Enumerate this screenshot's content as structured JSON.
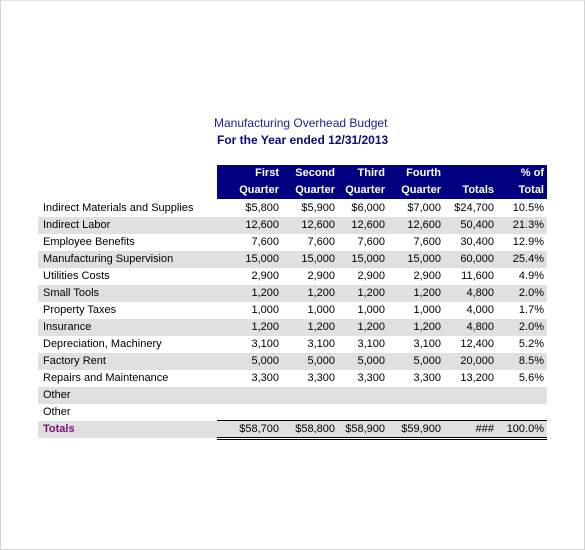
{
  "document": {
    "title": "Manufacturing Overhead Budget",
    "subtitle": "For the Year ended 12/31/2013"
  },
  "colors": {
    "header_bg": "#000080",
    "header_text": "#ffffff",
    "row_shade": "#e0e0e0",
    "title_text": "#1f1f8f",
    "totals_label": "#7f0f80"
  },
  "table": {
    "headers": [
      {
        "line1": "First",
        "line2": "Quarter"
      },
      {
        "line1": "Second",
        "line2": "Quarter"
      },
      {
        "line1": "Third",
        "line2": "Quarter"
      },
      {
        "line1": "Fourth",
        "line2": "Quarter"
      },
      {
        "line1": "",
        "line2": "Totals"
      },
      {
        "line1": "% of",
        "line2": "Total"
      }
    ],
    "rows": [
      {
        "label": "Indirect Materials and Supplies",
        "values": [
          "$5,800",
          "$5,900",
          "$6,000",
          "$7,000",
          "$24,700",
          "10.5%"
        ]
      },
      {
        "label": "Indirect Labor",
        "values": [
          "12,600",
          "12,600",
          "12,600",
          "12,600",
          "50,400",
          "21.3%"
        ]
      },
      {
        "label": "Employee Benefits",
        "values": [
          "7,600",
          "7,600",
          "7,600",
          "7,600",
          "30,400",
          "12.9%"
        ]
      },
      {
        "label": "Manufacturing Supervision",
        "values": [
          "15,000",
          "15,000",
          "15,000",
          "15,000",
          "60,000",
          "25.4%"
        ]
      },
      {
        "label": "Utilities Costs",
        "values": [
          "2,900",
          "2,900",
          "2,900",
          "2,900",
          "11,600",
          "4.9%"
        ]
      },
      {
        "label": "Small Tools",
        "values": [
          "1,200",
          "1,200",
          "1,200",
          "1,200",
          "4,800",
          "2.0%"
        ]
      },
      {
        "label": "Property Taxes",
        "values": [
          "1,000",
          "1,000",
          "1,000",
          "1,000",
          "4,000",
          "1.7%"
        ]
      },
      {
        "label": "Insurance",
        "values": [
          "1,200",
          "1,200",
          "1,200",
          "1,200",
          "4,800",
          "2.0%"
        ]
      },
      {
        "label": "Depreciation, Machinery",
        "values": [
          "3,100",
          "3,100",
          "3,100",
          "3,100",
          "12,400",
          "5.2%"
        ]
      },
      {
        "label": "Factory Rent",
        "values": [
          "5,000",
          "5,000",
          "5,000",
          "5,000",
          "20,000",
          "8.5%"
        ]
      },
      {
        "label": "Repairs and Maintenance",
        "values": [
          "3,300",
          "3,300",
          "3,300",
          "3,300",
          "13,200",
          "5.6%"
        ]
      },
      {
        "label": "Other",
        "values": [
          "",
          "",
          "",
          "",
          "",
          ""
        ]
      },
      {
        "label": "Other",
        "values": [
          "",
          "",
          "",
          "",
          "",
          ""
        ]
      }
    ],
    "totals": {
      "label": "Totals",
      "values": [
        "$58,700",
        "$58,800",
        "$58,900",
        "$59,900",
        "###",
        "100.0%"
      ]
    }
  }
}
